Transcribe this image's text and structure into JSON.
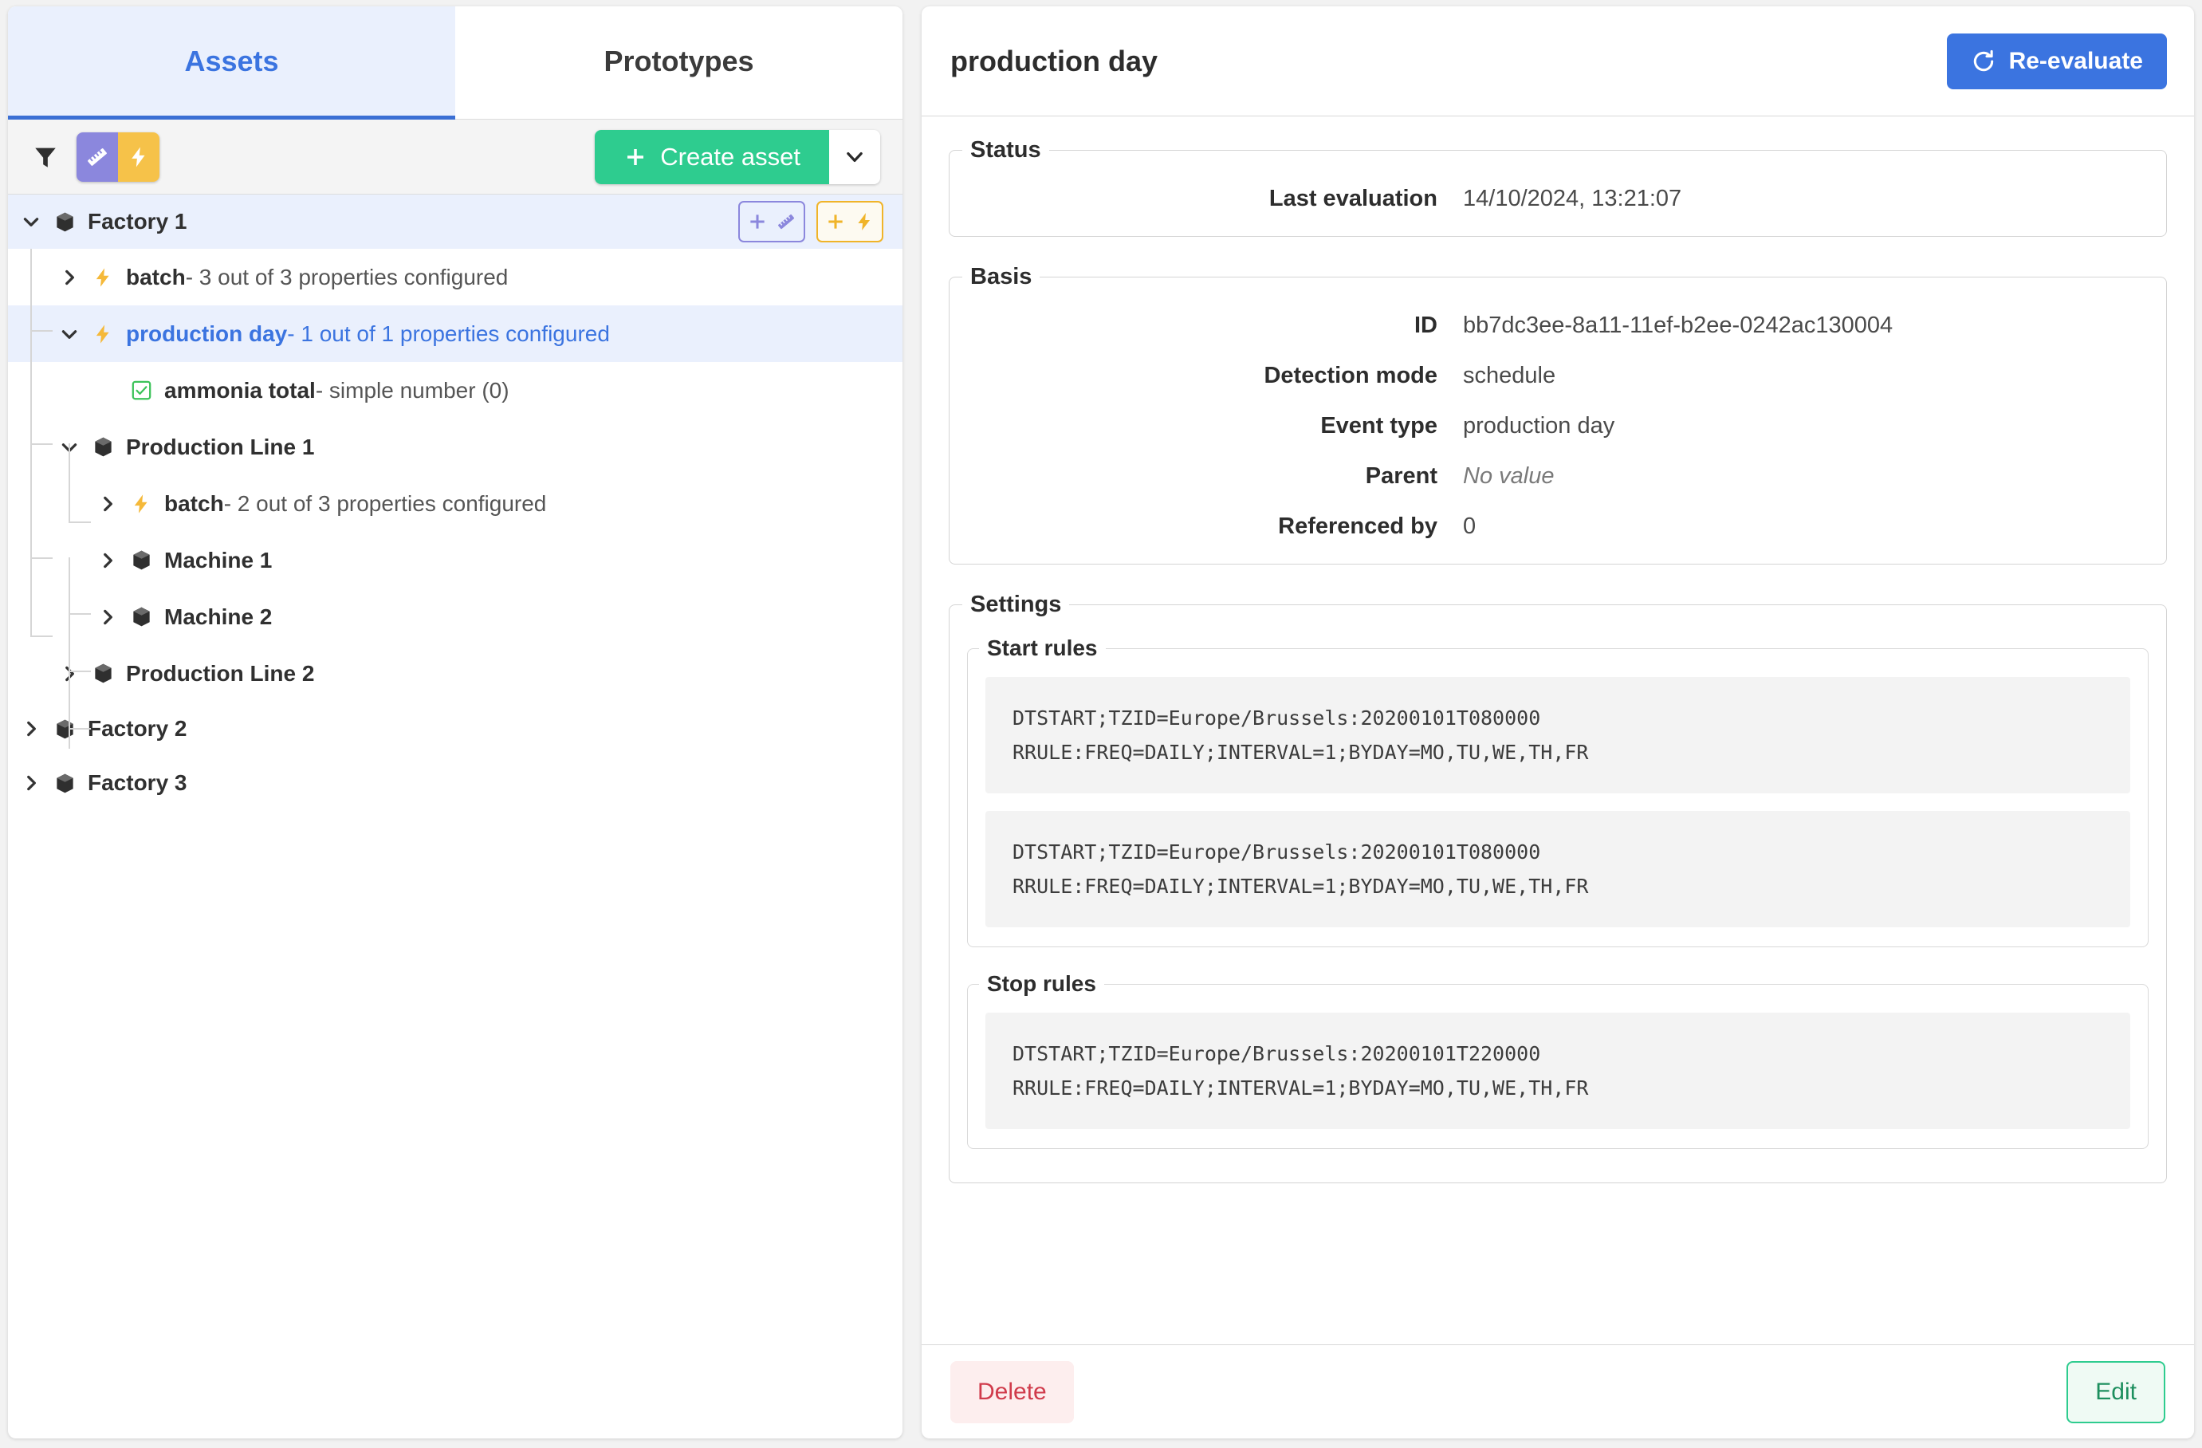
{
  "left": {
    "tabs": [
      {
        "label": "Assets",
        "active": true
      },
      {
        "label": "Prototypes",
        "active": false
      }
    ],
    "toolbar": {
      "filter_icon": "funnel-icon",
      "segment_measurement_icon": "ruler-icon",
      "segment_event_icon": "lightning-icon",
      "create_label": "Create asset",
      "create_plus": "+",
      "create_caret": "chevron-down-icon"
    },
    "tree": [
      {
        "id": "factory-1",
        "depth": 0,
        "icon": "cube-icon",
        "caret": "down",
        "name": "Factory 1",
        "desc": "",
        "selected": false,
        "row_highlight": true,
        "actions": [
          {
            "name": "add-measurement-button",
            "plus": "+",
            "icon": "ruler-icon"
          },
          {
            "name": "add-event-button",
            "plus": "+",
            "icon": "lightning-icon"
          }
        ]
      },
      {
        "id": "factory-1-batch",
        "depth": 1,
        "icon": "lightning-icon",
        "caret": "right",
        "name": "batch",
        "desc": " - 3 out of 3 properties configured",
        "selected": false
      },
      {
        "id": "production-day",
        "depth": 1,
        "icon": "lightning-icon",
        "caret": "down",
        "name": "production day",
        "desc": " - 1 out of 1 properties configured",
        "selected": true
      },
      {
        "id": "ammonia-total",
        "depth": 2,
        "icon": "checkbox-checked-icon",
        "caret": "none",
        "name": "ammonia total",
        "desc": " - simple number (0)",
        "selected": false
      },
      {
        "id": "production-line-1",
        "depth": 1,
        "icon": "cube-icon",
        "caret": "down",
        "name": "Production Line 1",
        "desc": "",
        "selected": false
      },
      {
        "id": "pl1-batch",
        "depth": 2,
        "icon": "lightning-icon",
        "caret": "right",
        "name": "batch",
        "desc": " - 2 out of 3 properties configured",
        "selected": false
      },
      {
        "id": "machine-1",
        "depth": 2,
        "icon": "cube-icon",
        "caret": "right",
        "name": "Machine 1",
        "desc": "",
        "selected": false
      },
      {
        "id": "machine-2",
        "depth": 2,
        "icon": "cube-icon",
        "caret": "right",
        "name": "Machine 2",
        "desc": "",
        "selected": false
      },
      {
        "id": "production-line-2",
        "depth": 1,
        "icon": "cube-icon",
        "caret": "right",
        "name": "Production Line 2",
        "desc": "",
        "selected": false
      },
      {
        "id": "factory-2",
        "depth": 0,
        "icon": "cube-icon",
        "caret": "right",
        "name": "Factory 2",
        "desc": "",
        "selected": false
      },
      {
        "id": "factory-3",
        "depth": 0,
        "icon": "cube-icon",
        "caret": "right",
        "name": "Factory 3",
        "desc": "",
        "selected": false
      }
    ]
  },
  "detail": {
    "title": "production day",
    "reevaluate_label": "Re-evaluate",
    "reevaluate_icon": "refresh-icon",
    "status": {
      "legend": "Status",
      "rows": [
        {
          "label": "Last evaluation",
          "value": "14/10/2024, 13:21:07",
          "muted": false
        }
      ]
    },
    "basis": {
      "legend": "Basis",
      "rows": [
        {
          "label": "ID",
          "value": "bb7dc3ee-8a11-11ef-b2ee-0242ac130004",
          "muted": false
        },
        {
          "label": "Detection mode",
          "value": "schedule",
          "muted": false
        },
        {
          "label": "Event type",
          "value": "production day",
          "muted": false
        },
        {
          "label": "Parent",
          "value": "No value",
          "muted": true
        },
        {
          "label": "Referenced by",
          "value": "0",
          "muted": false
        }
      ]
    },
    "settings": {
      "legend": "Settings",
      "start_rules": {
        "legend": "Start rules",
        "blocks": [
          "DTSTART;TZID=Europe/Brussels:20200101T080000\nRRULE:FREQ=DAILY;INTERVAL=1;BYDAY=MO,TU,WE,TH,FR",
          "DTSTART;TZID=Europe/Brussels:20200101T080000\nRRULE:FREQ=DAILY;INTERVAL=1;BYDAY=MO,TU,WE,TH,FR"
        ]
      },
      "stop_rules": {
        "legend": "Stop rules",
        "blocks": [
          "DTSTART;TZID=Europe/Brussels:20200101T220000\nRRULE:FREQ=DAILY;INTERVAL=1;BYDAY=MO,TU,WE,TH,FR"
        ]
      }
    },
    "footer": {
      "delete_label": "Delete",
      "edit_label": "Edit"
    }
  },
  "colors": {
    "accent_blue": "#3b74e0",
    "green": "#2ecc8f",
    "purple": "#8b87dd",
    "yellow": "#f6c249",
    "danger": "#d03b4b",
    "selected_row": "#eaf0fd"
  }
}
